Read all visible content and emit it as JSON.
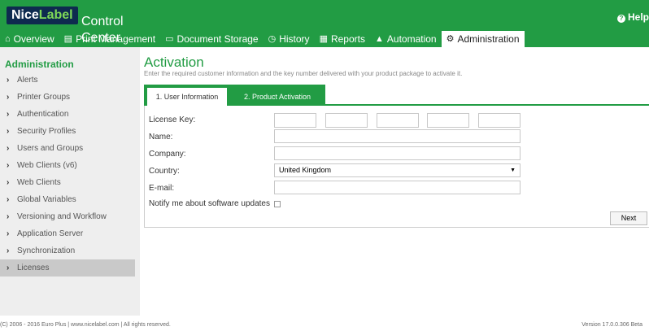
{
  "header": {
    "logo_nice": "Nice",
    "logo_label": "Label",
    "app_title": "Control Center",
    "help_label": "Help",
    "color": "#229c44"
  },
  "nav": [
    {
      "label": "Overview",
      "icon": "home-icon"
    },
    {
      "label": "Print Management",
      "icon": "printer-icon"
    },
    {
      "label": "Document Storage",
      "icon": "storage-icon"
    },
    {
      "label": "History",
      "icon": "clock-icon"
    },
    {
      "label": "Reports",
      "icon": "chart-icon"
    },
    {
      "label": "Automation",
      "icon": "automation-icon"
    },
    {
      "label": "Administration",
      "icon": "gears-icon",
      "active": true
    }
  ],
  "sidebar": {
    "title": "Administration",
    "items": [
      {
        "label": "Alerts"
      },
      {
        "label": "Printer Groups"
      },
      {
        "label": "Authentication"
      },
      {
        "label": "Security Profiles"
      },
      {
        "label": "Users and Groups"
      },
      {
        "label": "Web Clients (v6)"
      },
      {
        "label": "Web Clients"
      },
      {
        "label": "Global Variables"
      },
      {
        "label": "Versioning and Workflow"
      },
      {
        "label": "Application Server"
      },
      {
        "label": "Synchronization"
      },
      {
        "label": "Licenses",
        "active": true
      }
    ]
  },
  "main": {
    "title": "Activation",
    "subtitle": "Enter the required customer information and the key number delivered with your product package to activate it.",
    "tabs": [
      "1. User Information",
      "2. Product Activation"
    ],
    "form": {
      "license_key_label": "License Key:",
      "name_label": "Name:",
      "company_label": "Company:",
      "country_label": "Country:",
      "country_value": "United Kingdom",
      "email_label": "E-mail:",
      "notify_label": "Notify me about software updates",
      "notify_checked": false,
      "next_label": "Next"
    }
  },
  "footer": {
    "copyright": "(C) 2006 - 2016 Euro Plus  |  www.nicelabel.com  |  All rights reserved.",
    "version": "Version 17.0.0.306 Beta"
  }
}
